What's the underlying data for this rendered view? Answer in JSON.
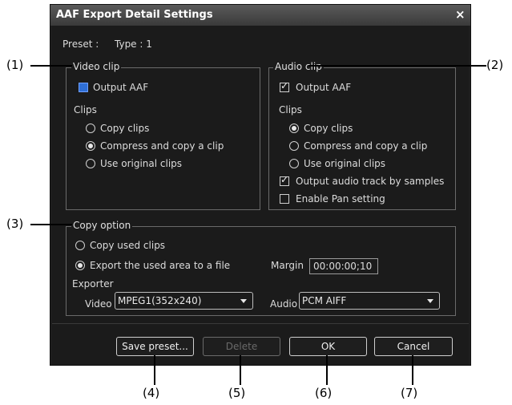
{
  "window": {
    "title": "AAF Export Detail Settings",
    "close_glyph": "×"
  },
  "preset_line": {
    "label": "Preset :",
    "type_text": "Type : 1"
  },
  "video_clip": {
    "group_label": "Video clip",
    "output_aaf": {
      "label": "Output AAF",
      "checked": false
    },
    "clips_label": "Clips",
    "options": [
      {
        "label": "Copy clips",
        "selected": false
      },
      {
        "label": "Compress and copy a clip",
        "selected": true
      },
      {
        "label": "Use original clips",
        "selected": false
      }
    ]
  },
  "audio_clip": {
    "group_label": "Audio clip",
    "output_aaf": {
      "label": "Output AAF",
      "checked": true
    },
    "clips_label": "Clips",
    "options": [
      {
        "label": "Copy clips",
        "selected": true
      },
      {
        "label": "Compress and copy a clip",
        "selected": false
      },
      {
        "label": "Use original clips",
        "selected": false
      }
    ],
    "output_by_samples": {
      "label": "Output audio track by samples",
      "checked": true
    },
    "enable_pan": {
      "label": "Enable Pan setting",
      "checked": false
    }
  },
  "copy_option": {
    "group_label": "Copy option",
    "options": [
      {
        "label": "Copy used clips",
        "selected": false
      },
      {
        "label": "Export the used area to a file",
        "selected": true
      }
    ],
    "margin_label": "Margin",
    "margin_value": "00:00:00;10",
    "exporter_label": "Exporter",
    "video_label": "Video",
    "video_value": "MPEG1(352x240)",
    "audio_label": "Audio",
    "audio_value": "PCM AIFF"
  },
  "buttons": {
    "save_preset": "Save preset...",
    "delete": "Delete",
    "ok": "OK",
    "cancel": "Cancel"
  },
  "callouts": {
    "c1": "(1)",
    "c2": "(2)",
    "c3": "(3)",
    "c4": "(4)",
    "c5": "(5)",
    "c6": "(6)",
    "c7": "(7)"
  },
  "colors": {
    "dialog_bg": "#1b1b1b",
    "titlebar": "#4a4a4a",
    "checkbox_blue": "#2f6fd6"
  }
}
